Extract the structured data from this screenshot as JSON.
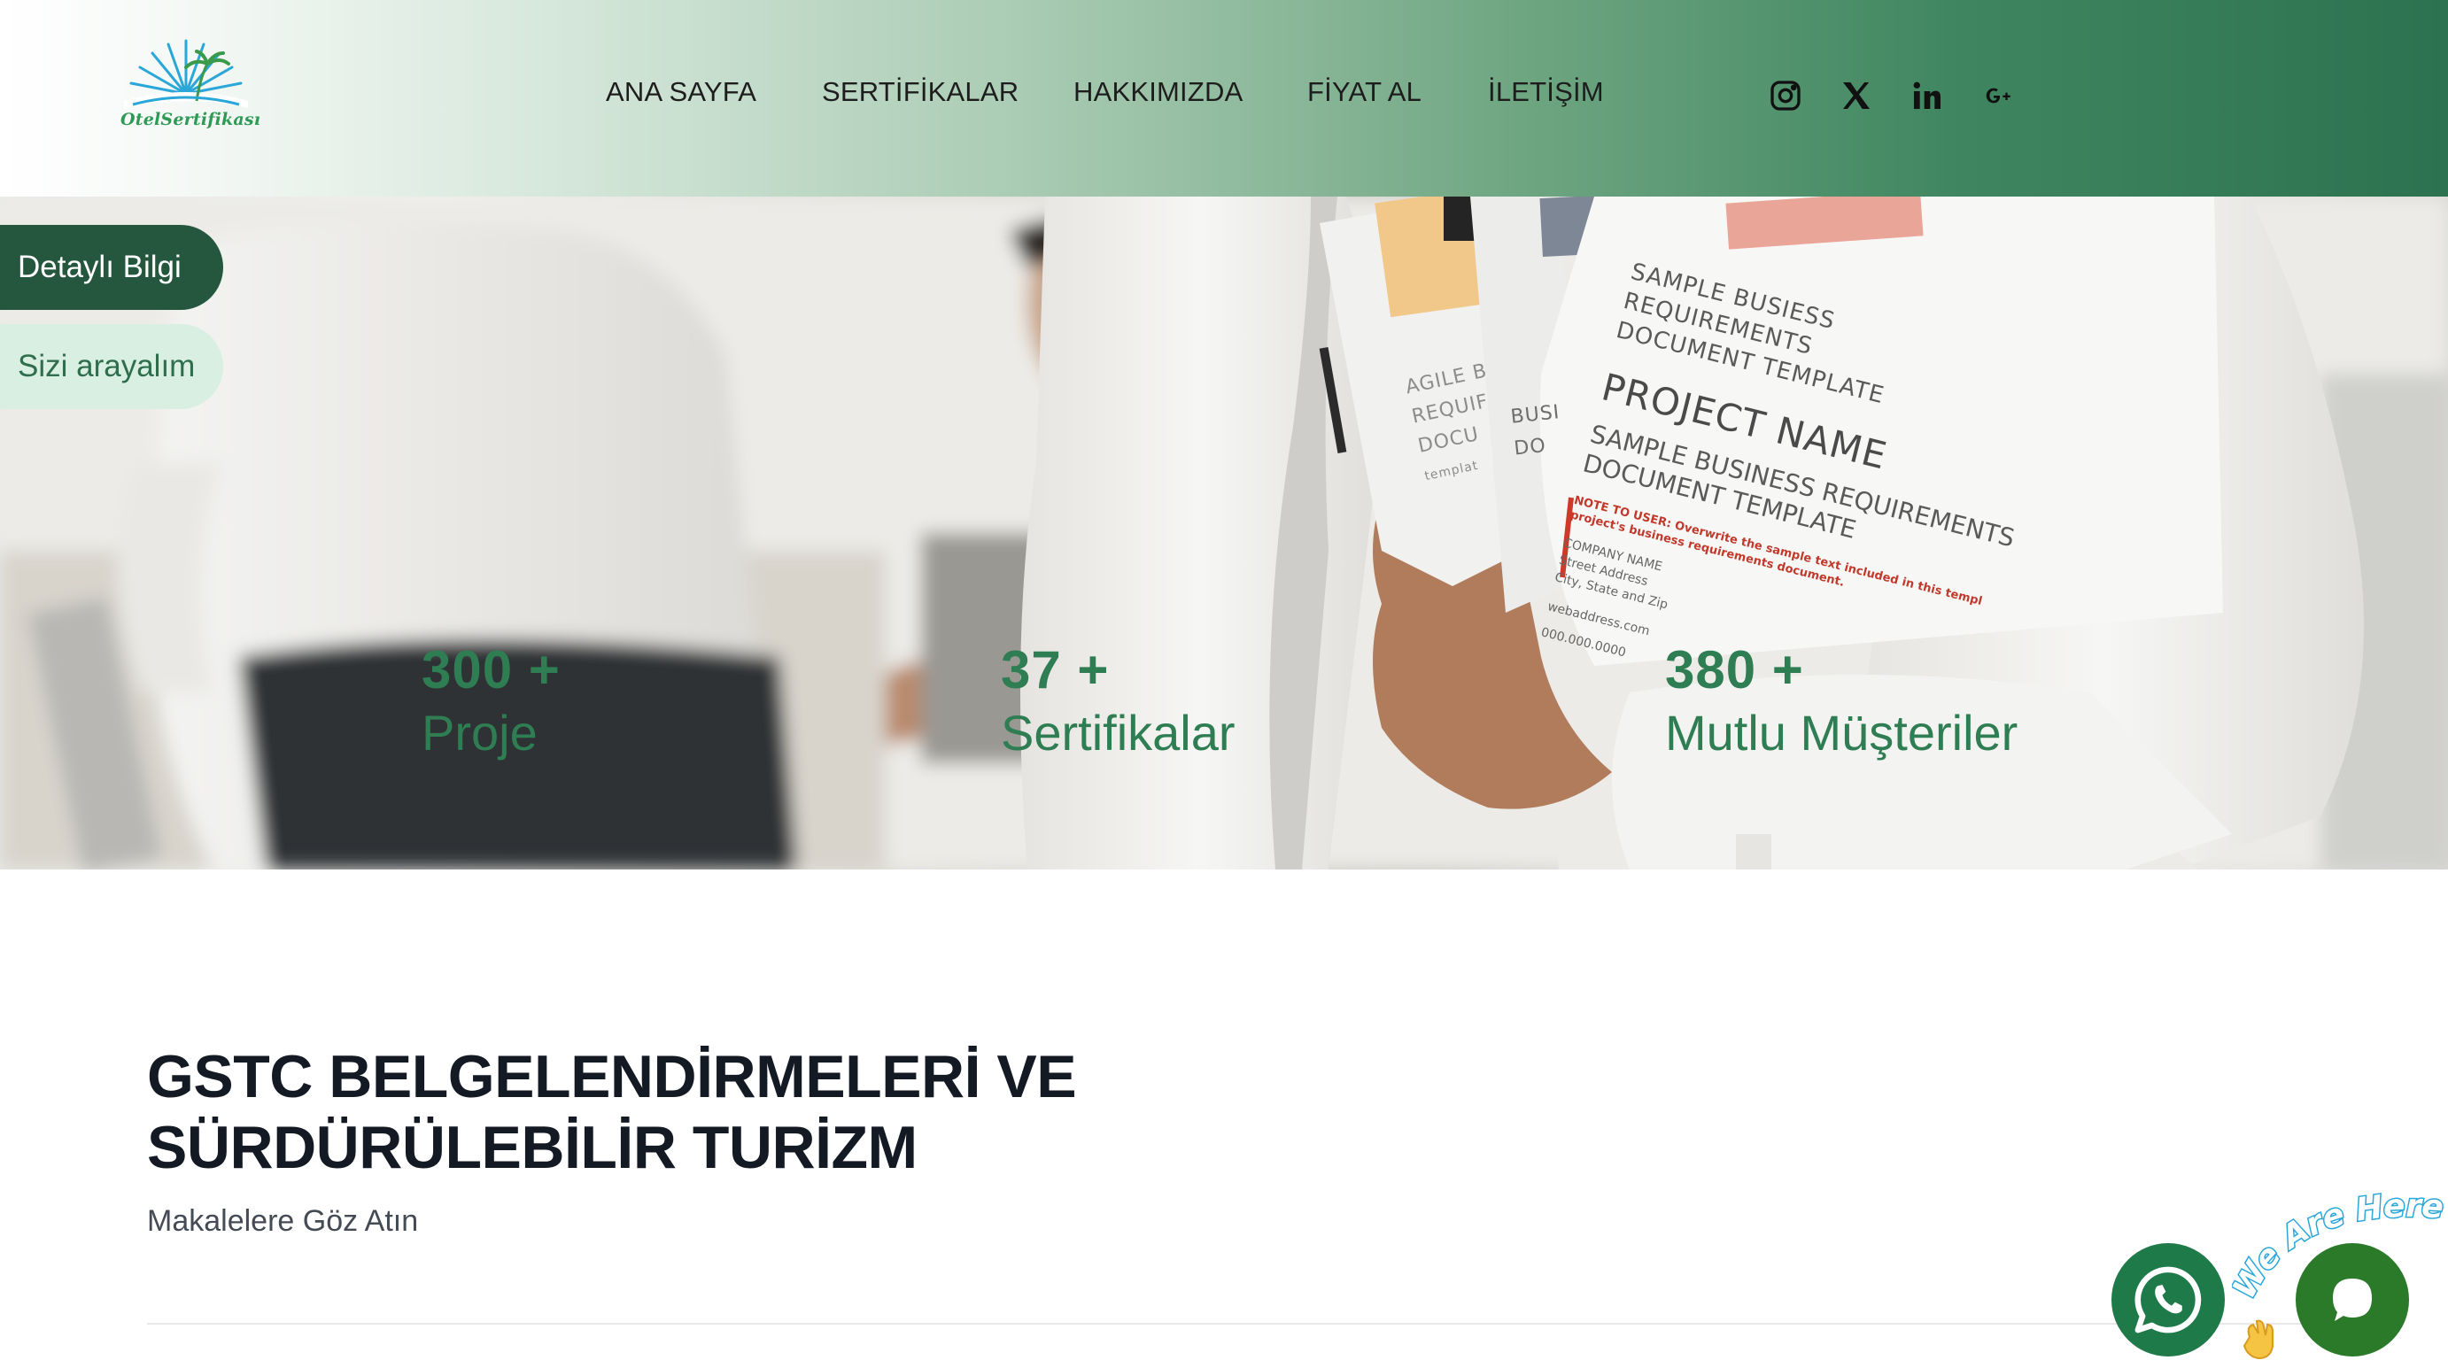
{
  "brand": {
    "logo_text": "OtelSertifikası"
  },
  "nav": {
    "items": [
      {
        "label": "ANA SAYFA"
      },
      {
        "label": "SERTİFİKALAR"
      },
      {
        "label": "HAKKIMIZDA"
      },
      {
        "label": "FİYAT AL"
      },
      {
        "label": "İLETİŞİM"
      }
    ]
  },
  "social": [
    "instagram-icon",
    "x-twitter-icon",
    "linkedin-icon",
    "google-plus-icon"
  ],
  "hero": {
    "buttons": {
      "detail": "Detaylı Bilgi",
      "call": "Sizi arayalım"
    },
    "stats": [
      {
        "number": "300 +",
        "label": "Proje"
      },
      {
        "number": "37 +",
        "label": "Sertifikalar"
      },
      {
        "number": "380 +",
        "label": "Mutlu Müşteriler"
      }
    ],
    "docs": {
      "sheet1_lines": [
        "AGILE B",
        "REQUIF",
        "DOCU"
      ],
      "sheet1_small": "templat",
      "sheet2_lines": [
        "BUSI",
        "DO"
      ],
      "sheet3_heading": [
        "SAMPLE BUSIESS",
        "REQUIREMENTS",
        "DOCUMENT TEMPLATE"
      ],
      "sheet3_title": "PROJECT NAME",
      "sheet3_sub": [
        "SAMPLE BUSINESS REQUIREMENTS",
        "DOCUMENT TEMPLATE"
      ],
      "sheet3_note": [
        "NOTE TO USER: Overwrite the sample text included in this templ",
        "project's business requirements document."
      ],
      "sheet3_address": [
        "COMPANY NAME",
        "Street Address",
        "City, State and Zip"
      ],
      "sheet3_web": "webaddress.com",
      "sheet3_phone": "000.000.0000"
    }
  },
  "content": {
    "title_line1": "GSTC BELGELENDİRMELERİ VE",
    "title_line2": "SÜRDÜRÜLEBİLİR TURİZM",
    "subtitle": "Makalelere Göz Atın"
  },
  "widgets": {
    "we_are_here": "We Are Here!"
  },
  "colors": {
    "brand_green": "#2f7d53",
    "dark_green": "#25573f",
    "mint": "#d8efe2"
  }
}
